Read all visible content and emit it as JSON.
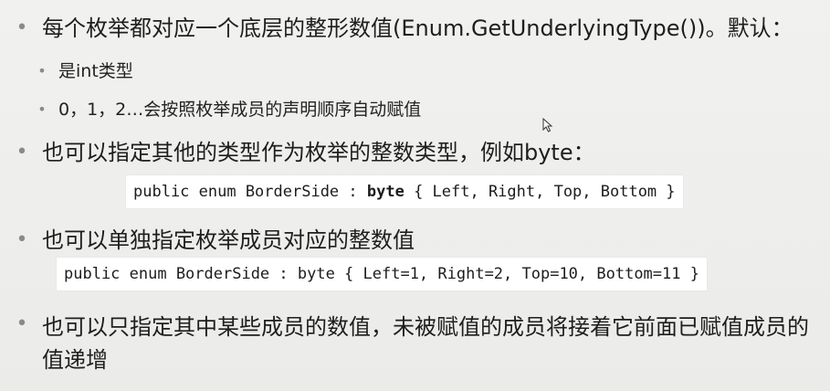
{
  "bullets": [
    {
      "level": 1,
      "text": "每个枚举都对应一个底层的整形数值(Enum.GetUnderlyingType())。默认："
    },
    {
      "level": 2,
      "text": "是int类型"
    },
    {
      "level": 2,
      "text": "0，1，2…会按照枚举成员的声明顺序自动赋值"
    },
    {
      "level": 1,
      "text": "也可以指定其他的类型作为枚举的整数类型，例如byte："
    },
    {
      "level": 1,
      "text": "也可以单独指定枚举成员对应的整数值"
    },
    {
      "level": 1,
      "text": "也可以只指定其中某些成员的数值，未被赋值的成员将接着它前面已赋值成员的值递增"
    }
  ],
  "code1": {
    "before": "public enum BorderSide : ",
    "keyword": "byte",
    "after": " { Left, Right, Top, Bottom }"
  },
  "code2": {
    "text": "public enum BorderSide : byte { Left=1, Right=2, Top=10, Bottom=11 }"
  },
  "bullet_glyph": "•",
  "colors": {
    "background": "#eeeeec",
    "bullet": "#8a8a8a",
    "code_background": "#ffffff"
  },
  "icons": {
    "cursor": "mouse-pointer-icon"
  }
}
